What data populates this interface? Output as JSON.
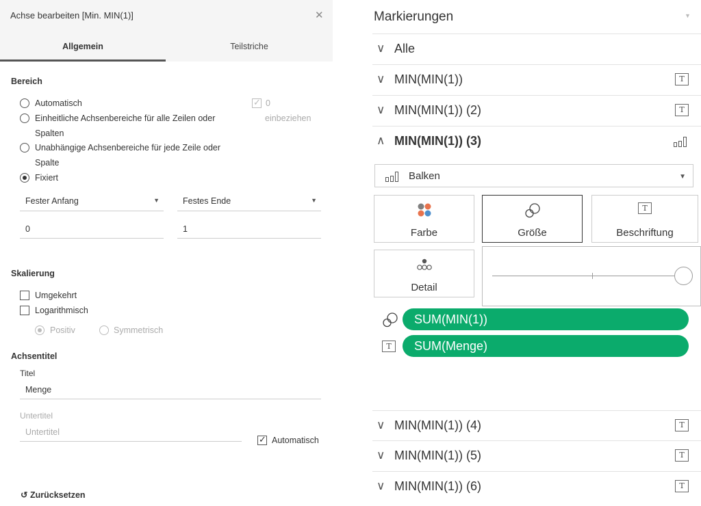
{
  "dialog": {
    "title": "Achse bearbeiten [Min. MIN(1)]",
    "close_icon": "close-icon",
    "tabs": [
      {
        "label": "Allgemein",
        "active": true
      },
      {
        "label": "Teilstriche",
        "active": false
      }
    ],
    "range": {
      "section_title": "Bereich",
      "options": [
        {
          "label": "Automatisch",
          "checked": false
        },
        {
          "label_line1": "Einheitliche Achsenbereiche für alle Zeilen oder",
          "label_line2": "Spalten",
          "checked": false
        },
        {
          "label_line1": "Unabhängige Achsenbereiche für jede Zeile oder",
          "label_line2": "Spalte",
          "checked": false
        },
        {
          "label": "Fixiert",
          "checked": true
        }
      ],
      "include_zero": {
        "label_line1": "0",
        "label_line2": "einbeziehen",
        "checked": true,
        "disabled": true
      },
      "start_dropdown": "Fester Anfang",
      "end_dropdown": "Festes Ende",
      "start_value": "0",
      "end_value": "1"
    },
    "scale": {
      "section_title": "Skalierung",
      "reversed": {
        "label": "Umgekehrt",
        "checked": false
      },
      "logarithmic": {
        "label": "Logarithmisch",
        "checked": false
      },
      "positive": {
        "label": "Positiv",
        "checked": true,
        "disabled": true
      },
      "symmetric": {
        "label": "Symmetrisch",
        "checked": false,
        "disabled": true
      }
    },
    "axis_title": {
      "section_title": "Achsentitel",
      "title_label": "Titel",
      "title_value": "Menge",
      "subtitle_label": "Untertitel",
      "subtitle_placeholder": "Untertitel",
      "automatic": {
        "label": "Automatisch",
        "checked": true
      }
    },
    "reset_label": "Zurücksetzen"
  },
  "marks": {
    "title": "Markierungen",
    "rows_top": [
      {
        "label": "Alle",
        "chevron": "chevron-down-icon",
        "icon": ""
      },
      {
        "label": "MIN(MIN(1))",
        "chevron": "chevron-down-icon",
        "icon": "T"
      },
      {
        "label": "MIN(MIN(1)) (2)",
        "chevron": "chevron-down-icon",
        "icon": "T"
      }
    ],
    "expanded_row": {
      "label": "MIN(MIN(1)) (3)",
      "chevron": "chevron-up-icon",
      "icon": "bar-chart-icon"
    },
    "mark_type": "Balken",
    "cards": {
      "color": "Farbe",
      "size": "Größe",
      "label": "Beschriftung",
      "detail": "Detail",
      "label_icon": "T"
    },
    "pills": [
      {
        "icon": "size-icon",
        "label": "SUM(MIN(1))"
      },
      {
        "icon": "T",
        "label": "SUM(Menge)"
      }
    ],
    "rows_bottom": [
      {
        "label": "MIN(MIN(1)) (4)",
        "chevron": "chevron-down-icon",
        "icon": "T"
      },
      {
        "label": "MIN(MIN(1)) (5)",
        "chevron": "chevron-down-icon",
        "icon": "T"
      },
      {
        "label": "MIN(MIN(1)) (6)",
        "chevron": "chevron-down-icon",
        "icon": "T"
      }
    ],
    "pill_color": "#0bab6c"
  }
}
